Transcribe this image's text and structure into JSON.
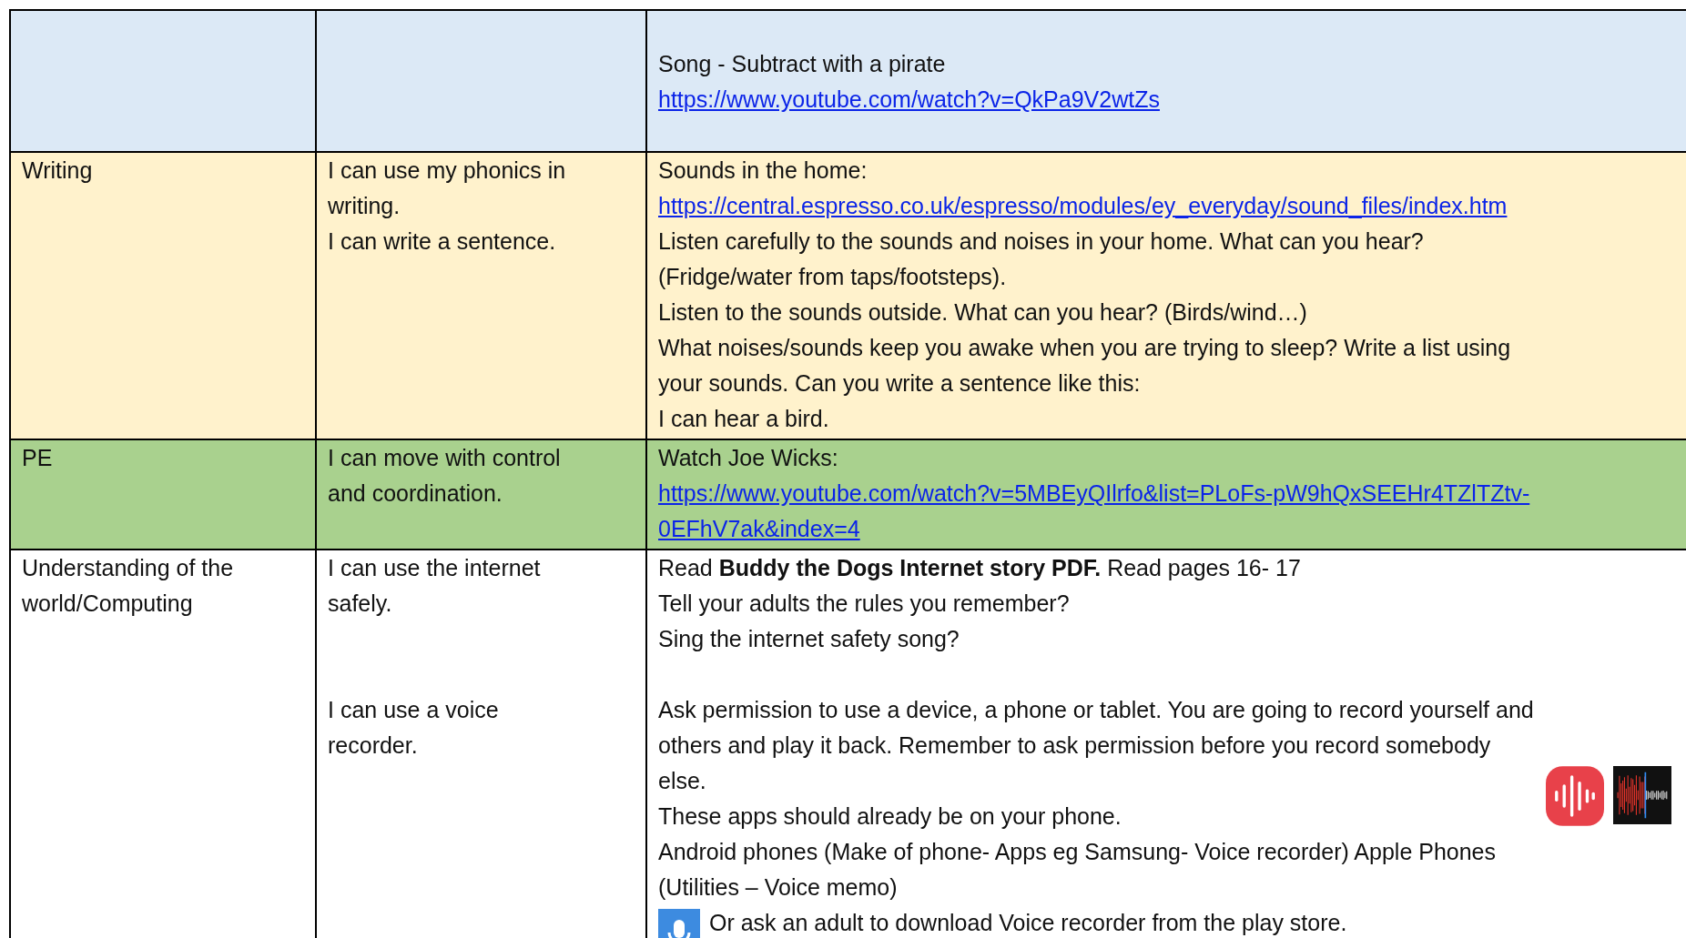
{
  "rows": [
    {
      "color": "#dce9f6",
      "subject": [],
      "objectives": [],
      "activities": [
        {
          "kind": "text",
          "gap_before": true,
          "lines": [
            "Song - Subtract with a pirate"
          ]
        },
        {
          "kind": "link",
          "gap_before": false,
          "lines": [
            "https://www.youtube.com/watch?v=QkPa9V2wtZs"
          ]
        }
      ]
    },
    {
      "color": "#fff2cc",
      "subject": [
        [
          "Writing"
        ]
      ],
      "objectives": [
        {
          "gap_before": false,
          "lines": [
            "I can use my phonics in",
            "writing.",
            "I can write a sentence."
          ]
        }
      ],
      "activities": [
        {
          "kind": "text",
          "gap_before": false,
          "lines": [
            "Sounds in the home:"
          ]
        },
        {
          "kind": "link",
          "gap_before": false,
          "lines": [
            "https://central.espresso.co.uk/espresso/modules/ey_everyday/sound_files/index.htm"
          ]
        },
        {
          "kind": "text",
          "gap_before": false,
          "lines": [
            "Listen carefully to the sounds and noises in your home. What can you hear?",
            "(Fridge/water from taps/footsteps)."
          ]
        },
        {
          "kind": "text",
          "gap_before": false,
          "lines": [
            "Listen to the sounds outside. What can you hear? (Birds/wind…)"
          ]
        },
        {
          "kind": "text",
          "gap_before": false,
          "lines": [
            "What noises/sounds keep you awake when you are trying to sleep? Write a list using",
            "your sounds. Can you write a sentence like this:"
          ]
        },
        {
          "kind": "text",
          "gap_before": false,
          "lines": [
            "I can hear a bird."
          ]
        }
      ]
    },
    {
      "color": "#a9d18e",
      "subject": [
        [
          "PE"
        ]
      ],
      "objectives": [
        {
          "gap_before": false,
          "lines": [
            "I can move with control",
            "and coordination."
          ]
        }
      ],
      "activities": [
        {
          "kind": "text",
          "gap_before": false,
          "lines": [
            "Watch Joe Wicks:"
          ]
        },
        {
          "kind": "link",
          "gap_before": false,
          "lines": [
            "https://www.youtube.com/watch?v=5MBEyQIlrfo&list=PLoFs-pW9hQxSEEHr4TZlTZtv-",
            "0EFhV7ak&index=4"
          ]
        }
      ]
    },
    {
      "color": "#ffffff",
      "subject": [
        [
          "Understanding of the",
          "world/Computing"
        ]
      ],
      "objectives": [
        {
          "gap_before": false,
          "lines": [
            "I can use the internet",
            "safely."
          ]
        },
        {
          "gap_before": true,
          "lines": [
            "I can use a voice",
            "recorder."
          ]
        }
      ],
      "activities": [
        {
          "kind": "text",
          "gap_before": false,
          "lines": [
            "Read **Buddy the Dogs Internet story PDF.** Read pages 16- 17"
          ]
        },
        {
          "kind": "text",
          "gap_before": false,
          "lines": [
            "Tell your adults the rules you remember?"
          ]
        },
        {
          "kind": "text",
          "gap_before": false,
          "lines": [
            "Sing the internet safety song?"
          ]
        },
        {
          "kind": "text",
          "gap_before": true,
          "lines": [
            "Ask permission to use a device, a phone or tablet. You are going to record yourself and",
            "others and play it back. Remember to ask permission before you record somebody",
            "else."
          ]
        },
        {
          "kind": "apps",
          "gap_before": false,
          "lines": [
            "These apps should already be on your phone."
          ]
        },
        {
          "kind": "text",
          "gap_before": false,
          "lines": [
            "Android phones (Make of phone- Apps eg Samsung- Voice recorder) Apple Phones",
            "(Utilities – Voice memo)"
          ]
        },
        {
          "kind": "mic",
          "gap_before": false,
          "lines": [
            "Or ask an adult to download Voice recorder from the play store."
          ]
        }
      ]
    }
  ]
}
